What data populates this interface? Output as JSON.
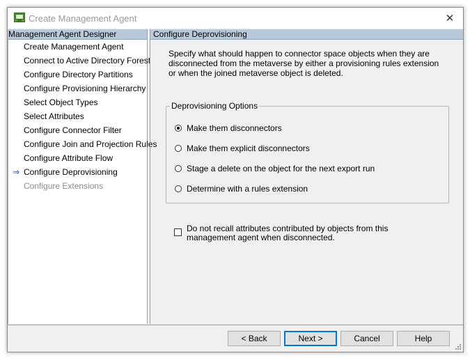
{
  "window": {
    "title": "Create Management Agent",
    "close_glyph": "✕"
  },
  "left_panel": {
    "header": "Management Agent Designer",
    "current_arrow": "⇒",
    "items": [
      {
        "label": "Create Management Agent"
      },
      {
        "label": "Connect to Active Directory Forest"
      },
      {
        "label": "Configure Directory Partitions"
      },
      {
        "label": "Configure Provisioning Hierarchy"
      },
      {
        "label": "Select Object Types"
      },
      {
        "label": "Select Attributes"
      },
      {
        "label": "Configure Connector Filter"
      },
      {
        "label": "Configure Join and Projection Rules"
      },
      {
        "label": "Configure Attribute Flow"
      },
      {
        "label": "Configure Deprovisioning"
      },
      {
        "label": "Configure Extensions"
      }
    ]
  },
  "right_panel": {
    "header": "Configure Deprovisioning",
    "description": "Specify what should happen to connector space objects when they are disconnected from the metaverse by either a provisioning rules extension or when the joined metaverse object is deleted.",
    "options_group": {
      "legend": "Deprovisioning Options",
      "options": [
        {
          "label": "Make them disconnectors",
          "selected": true
        },
        {
          "label": "Make them explicit disconnectors",
          "selected": false
        },
        {
          "label": "Stage a delete on the object for the next export run",
          "selected": false
        },
        {
          "label": "Determine with a rules extension",
          "selected": false
        }
      ]
    },
    "recall_checkbox": {
      "label": "Do not recall attributes contributed by objects from this management agent when disconnected.",
      "checked": false
    }
  },
  "buttons": {
    "back": "< Back",
    "next": "Next >",
    "cancel": "Cancel",
    "help": "Help"
  }
}
